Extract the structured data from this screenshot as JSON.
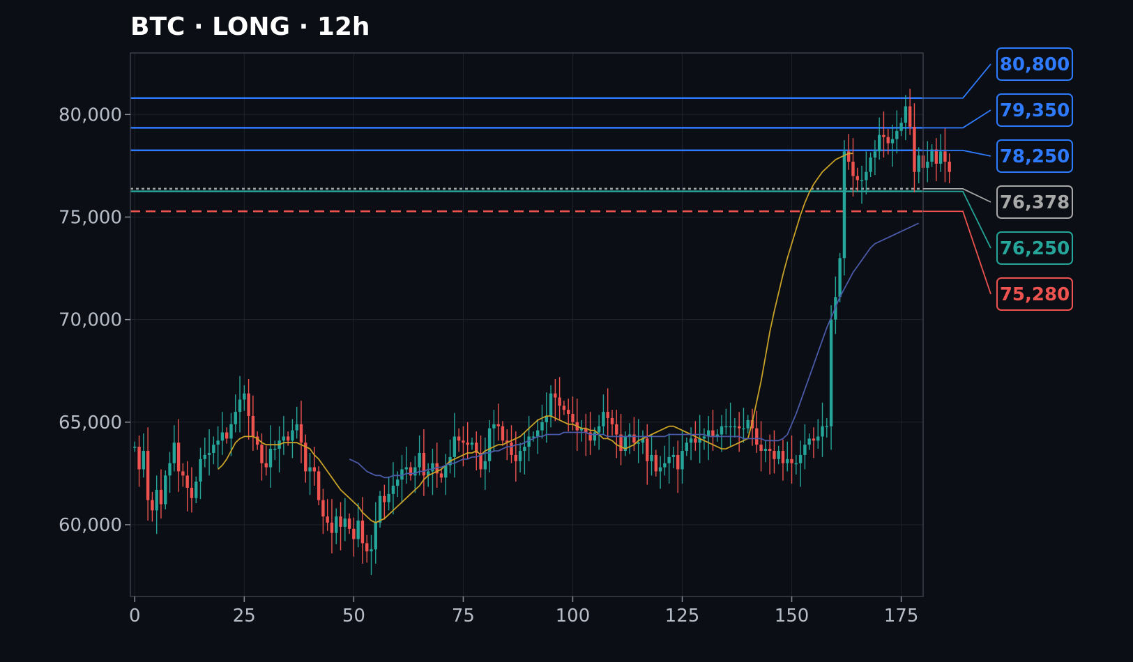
{
  "chart_data": {
    "type": "candlestick",
    "title": "BTC · LONG · 12h",
    "xlabel": "",
    "ylabel": "",
    "xlim": [
      -1,
      180
    ],
    "ylim": [
      56500,
      83000
    ],
    "x_ticks": [
      0,
      25,
      50,
      75,
      100,
      125,
      150,
      175
    ],
    "y_ticks": [
      60000,
      65000,
      70000,
      75000,
      80000
    ],
    "y_tick_labels": [
      "60,000",
      "65,000",
      "70,000",
      "75,000",
      "80,000"
    ],
    "grid": true,
    "colors": {
      "background": "#0b0e14",
      "up": "#26a69a",
      "down": "#ef5350",
      "ma_fast": "#c9a227",
      "ma_slow": "#4a5aa8",
      "grid": "#1e232c",
      "axis": "#3a3f4a",
      "tick_text": "#b8bec8"
    },
    "candles": {
      "x_start": 0,
      "close": [
        63800,
        62700,
        63600,
        61200,
        60700,
        61700,
        61000,
        62400,
        63000,
        64000,
        62600,
        62400,
        61800,
        61300,
        62100,
        63200,
        63400,
        63500,
        63900,
        64100,
        64500,
        64200,
        64900,
        65500,
        66100,
        66400,
        65300,
        64300,
        63900,
        63000,
        62800,
        63700,
        63700,
        64100,
        64300,
        64100,
        64600,
        64900,
        64000,
        62600,
        62800,
        62600,
        61200,
        60400,
        60100,
        59600,
        60400,
        59900,
        60300,
        59800,
        59300,
        60200,
        59100,
        58700,
        58800,
        60100,
        61400,
        61100,
        61500,
        61900,
        62200,
        62700,
        62800,
        62400,
        62800,
        63500,
        62400,
        62600,
        63000,
        62500,
        62300,
        62900,
        63300,
        64300,
        64100,
        64000,
        63900,
        64000,
        63500,
        62700,
        63100,
        64700,
        64900,
        64800,
        64100,
        64000,
        63400,
        63100,
        63600,
        63800,
        64300,
        64300,
        64600,
        65000,
        65300,
        66400,
        66200,
        65800,
        65600,
        65400,
        65000,
        64600,
        64700,
        64500,
        64100,
        64500,
        64800,
        65500,
        65200,
        64900,
        64400,
        63600,
        64300,
        64400,
        64000,
        64000,
        64200,
        63100,
        63400,
        62600,
        62800,
        63000,
        63300,
        63400,
        62700,
        63600,
        64000,
        64200,
        64000,
        64200,
        64300,
        64600,
        64300,
        64400,
        64800,
        64800,
        64800,
        64800,
        64700,
        64700,
        65100,
        64700,
        63900,
        63600,
        63700,
        63600,
        63200,
        63600,
        63000,
        63200,
        63000,
        63000,
        63400,
        63900,
        64200,
        64100,
        64300,
        64800,
        64800,
        70000,
        71100,
        73000,
        78200,
        77700,
        77000,
        76800,
        76800,
        77200,
        77900,
        78200,
        79000,
        78900,
        78600,
        78800,
        79200,
        79600,
        80400,
        79400,
        77200,
        78000,
        77400,
        77700,
        78300,
        77600,
        78200,
        77700,
        77200
      ],
      "open": [
        63800,
        63800,
        62700,
        63600,
        61200,
        60700,
        61700,
        61000,
        62400,
        63000,
        64000,
        62600,
        62400,
        61800,
        61300,
        62100,
        63200,
        63400,
        63500,
        63900,
        64100,
        64500,
        64200,
        64900,
        65500,
        66100,
        66400,
        65300,
        64300,
        63900,
        63000,
        62800,
        63700,
        63700,
        64100,
        64300,
        64100,
        64600,
        64900,
        64000,
        62600,
        62800,
        62600,
        61200,
        60400,
        60100,
        59600,
        60400,
        59900,
        60300,
        59800,
        59300,
        60200,
        59100,
        58700,
        58800,
        60100,
        61400,
        61100,
        61500,
        61900,
        62200,
        62700,
        62800,
        62400,
        62800,
        63500,
        62400,
        62600,
        63000,
        62500,
        62300,
        62900,
        63300,
        64300,
        64100,
        64000,
        63900,
        64000,
        63500,
        62700,
        63100,
        64700,
        64900,
        64800,
        64100,
        64000,
        63400,
        63100,
        63600,
        63800,
        64300,
        64300,
        64600,
        65000,
        65300,
        66400,
        66200,
        65800,
        65600,
        65400,
        65000,
        64600,
        64700,
        64500,
        64100,
        64500,
        64800,
        65500,
        65200,
        64900,
        64400,
        63600,
        64300,
        64400,
        64000,
        64000,
        64200,
        63100,
        63400,
        62600,
        62800,
        63000,
        63300,
        63400,
        62700,
        63600,
        64000,
        64200,
        64000,
        64200,
        64300,
        64600,
        64300,
        64400,
        64800,
        64800,
        64800,
        64800,
        64700,
        64700,
        65100,
        64700,
        63900,
        63600,
        63700,
        63600,
        63200,
        63600,
        63000,
        63200,
        63000,
        63000,
        63400,
        63900,
        64200,
        64100,
        64300,
        64800,
        64800,
        70000,
        71100,
        73000,
        78200,
        77700,
        77000,
        76800,
        76800,
        77200,
        77900,
        78200,
        79000,
        78900,
        78600,
        78800,
        79200,
        79600,
        80400,
        79400,
        77200,
        78000,
        77400,
        77700,
        78300,
        77600,
        78200,
        77700
      ]
    },
    "series": [
      {
        "x_start": 19,
        "values": [
          62700,
          62900,
          63200,
          63600,
          64000,
          64200,
          64300,
          64300,
          64300,
          64200,
          64000,
          63900,
          63900,
          63900,
          63900,
          64000,
          64000,
          64000,
          64000,
          63900,
          63800,
          63700,
          63400,
          63200,
          62900,
          62600,
          62300,
          62000,
          61700,
          61500,
          61300,
          61100,
          60900,
          60600,
          60400,
          60200,
          60100,
          60200,
          60300,
          60500,
          60700,
          60900,
          61100,
          61300,
          61500,
          61700,
          61900,
          62200,
          62400,
          62500,
          62600,
          62700,
          62900,
          63100,
          63200,
          63300,
          63400,
          63500,
          63500,
          63600,
          63400,
          63600,
          63700,
          63800,
          63900,
          63900,
          64000,
          64100,
          64200,
          64300,
          64500,
          64700,
          64900,
          65100,
          65200,
          65300,
          65300,
          65200,
          65100,
          65000,
          64900,
          64900,
          64800,
          64700,
          64700,
          64600,
          64600,
          64400,
          64200,
          64200,
          64100,
          63900,
          63800,
          63700,
          63800,
          63900,
          64100,
          64200,
          64300,
          64400,
          64500,
          64600,
          64700,
          64800,
          64800,
          64700,
          64600,
          64500,
          64400,
          64300,
          64200,
          64100,
          64000,
          63900,
          63800,
          63700,
          63700,
          63800,
          63900,
          64000,
          64100,
          64200,
          65000,
          66000,
          67000,
          68200,
          69400,
          70400,
          71300,
          72200,
          73000,
          73700,
          74400,
          75100,
          75700,
          76200,
          76600,
          76900,
          77200,
          77400,
          77600,
          77800,
          77900,
          78000,
          78100,
          78100
        ],
        "name": ""
      },
      {
        "x_start": 49,
        "values": [
          63200,
          63100,
          63000,
          62800,
          62600,
          62500,
          62400,
          62400,
          62300,
          62300,
          62400,
          62400,
          62400,
          62500,
          62500,
          62500,
          62600,
          62600,
          62700,
          62700,
          62800,
          62800,
          62900,
          63000,
          63000,
          63100,
          63200,
          63200,
          63300,
          63300,
          63400,
          63500,
          63500,
          63600,
          63600,
          63700,
          63800,
          63800,
          63900,
          63900,
          64000,
          64100,
          64200,
          64300,
          64300,
          64400,
          64400,
          64400,
          64400,
          64500,
          64500,
          64500,
          64500,
          64500,
          64500,
          64400,
          64400,
          64400,
          64400,
          64300,
          64300,
          64300,
          64300,
          64300,
          64300,
          64300,
          64300,
          64300,
          64300,
          64300,
          64300,
          64300,
          64300,
          64400,
          64400,
          64400,
          64400,
          64400,
          64400,
          64400,
          64400,
          64400,
          64300,
          64300,
          64300,
          64300,
          64300,
          64300,
          64300,
          64300,
          64200,
          64200,
          64200,
          64200,
          64200,
          64100,
          64100,
          64100,
          64100,
          64200,
          64400,
          64900,
          65400,
          66000,
          66600,
          67200,
          67800,
          68400,
          69000,
          69600,
          70100,
          70600,
          71100,
          71500,
          71900,
          72300,
          72600,
          72900,
          73200,
          73500,
          73700,
          73800,
          73900,
          74000,
          74100,
          74200,
          74300,
          74400,
          74500,
          74600,
          74700
        ],
        "name": ""
      }
    ],
    "levels": [
      {
        "value": 80800,
        "label": "80,800",
        "color": "#2f7bff",
        "style": "solid"
      },
      {
        "value": 79350,
        "label": "79,350",
        "color": "#2f7bff",
        "style": "solid"
      },
      {
        "value": 78250,
        "label": "78,250",
        "color": "#2f7bff",
        "style": "solid"
      },
      {
        "value": 76378,
        "label": "76,378",
        "color": "#a8a8a8",
        "style": "dotted"
      },
      {
        "value": 76250,
        "label": "76,250",
        "color": "#26a69a",
        "style": "solid"
      },
      {
        "value": 75280,
        "label": "75,280",
        "color": "#ef5350",
        "style": "dashed"
      }
    ]
  }
}
